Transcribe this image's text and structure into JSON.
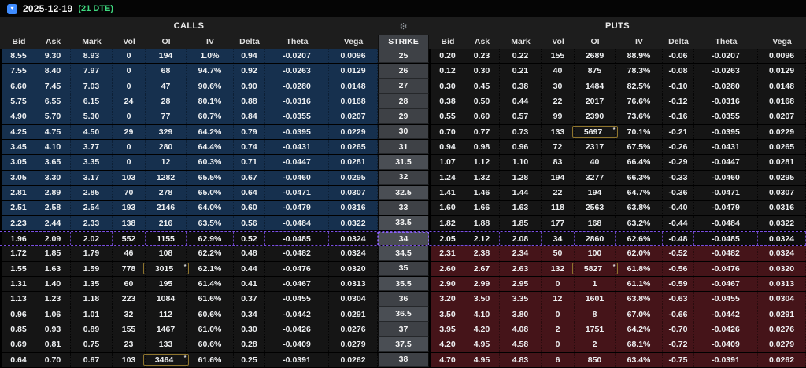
{
  "titlebar": {
    "date": "2025-12-19",
    "dte": "(21 DTE)",
    "expander_icon": "chevron-down",
    "expander_glyph": "▾"
  },
  "header": {
    "calls": "CALLS",
    "puts": "PUTS",
    "strike": "STRIKE",
    "gear_icon": "gear",
    "gear_glyph": "⚙",
    "columns": [
      "Bid",
      "Ask",
      "Mark",
      "Vol",
      "OI",
      "IV",
      "Delta",
      "Theta",
      "Vega"
    ],
    "column_keys": [
      "bid",
      "ask",
      "mark",
      "vol",
      "oi",
      "iv",
      "delta",
      "theta",
      "vega"
    ]
  },
  "colors": {
    "call_itm_bg": "#16304e",
    "put_itm_bg": "#451419",
    "neutral_row_bg": "#151515",
    "strike_bg": "#3e4146",
    "strike_half_bg": "#4a4e54",
    "atm_dash": "#7a4fe0",
    "oi_highlight_border": "#8e742d",
    "dte_green": "#3fd97f",
    "expander_blue": "#3f8cff",
    "header_bg": "#1d1d1d"
  },
  "rows": [
    {
      "strike": "25",
      "half": false,
      "atm": false,
      "call_itm": true,
      "put_itm": false,
      "call_oi_flag": false,
      "put_oi_flag": false,
      "call": [
        "8.55",
        "9.30",
        "8.93",
        "0",
        "194",
        "1.0%",
        "0.94",
        "-0.0207",
        "0.0096"
      ],
      "put": [
        "0.20",
        "0.23",
        "0.22",
        "155",
        "2689",
        "88.9%",
        "-0.06",
        "-0.0207",
        "0.0096"
      ]
    },
    {
      "strike": "26",
      "half": false,
      "atm": false,
      "call_itm": true,
      "put_itm": false,
      "call_oi_flag": false,
      "put_oi_flag": false,
      "call": [
        "7.55",
        "8.40",
        "7.97",
        "0",
        "68",
        "94.7%",
        "0.92",
        "-0.0263",
        "0.0129"
      ],
      "put": [
        "0.12",
        "0.30",
        "0.21",
        "40",
        "875",
        "78.3%",
        "-0.08",
        "-0.0263",
        "0.0129"
      ]
    },
    {
      "strike": "27",
      "half": false,
      "atm": false,
      "call_itm": true,
      "put_itm": false,
      "call_oi_flag": false,
      "put_oi_flag": false,
      "call": [
        "6.60",
        "7.45",
        "7.03",
        "0",
        "47",
        "90.6%",
        "0.90",
        "-0.0280",
        "0.0148"
      ],
      "put": [
        "0.30",
        "0.45",
        "0.38",
        "30",
        "1484",
        "82.5%",
        "-0.10",
        "-0.0280",
        "0.0148"
      ]
    },
    {
      "strike": "28",
      "half": false,
      "atm": false,
      "call_itm": true,
      "put_itm": false,
      "call_oi_flag": false,
      "put_oi_flag": false,
      "call": [
        "5.75",
        "6.55",
        "6.15",
        "24",
        "28",
        "80.1%",
        "0.88",
        "-0.0316",
        "0.0168"
      ],
      "put": [
        "0.38",
        "0.50",
        "0.44",
        "22",
        "2017",
        "76.6%",
        "-0.12",
        "-0.0316",
        "0.0168"
      ]
    },
    {
      "strike": "29",
      "half": false,
      "atm": false,
      "call_itm": true,
      "put_itm": false,
      "call_oi_flag": false,
      "put_oi_flag": false,
      "call": [
        "4.90",
        "5.70",
        "5.30",
        "0",
        "77",
        "60.7%",
        "0.84",
        "-0.0355",
        "0.0207"
      ],
      "put": [
        "0.55",
        "0.60",
        "0.57",
        "99",
        "2390",
        "73.6%",
        "-0.16",
        "-0.0355",
        "0.0207"
      ]
    },
    {
      "strike": "30",
      "half": false,
      "atm": false,
      "call_itm": true,
      "put_itm": false,
      "call_oi_flag": false,
      "put_oi_flag": true,
      "call": [
        "4.25",
        "4.75",
        "4.50",
        "29",
        "329",
        "64.2%",
        "0.79",
        "-0.0395",
        "0.0229"
      ],
      "put": [
        "0.70",
        "0.77",
        "0.73",
        "133",
        "5697",
        "70.1%",
        "-0.21",
        "-0.0395",
        "0.0229"
      ]
    },
    {
      "strike": "31",
      "half": false,
      "atm": false,
      "call_itm": true,
      "put_itm": false,
      "call_oi_flag": false,
      "put_oi_flag": false,
      "call": [
        "3.45",
        "4.10",
        "3.77",
        "0",
        "280",
        "64.4%",
        "0.74",
        "-0.0431",
        "0.0265"
      ],
      "put": [
        "0.94",
        "0.98",
        "0.96",
        "72",
        "2317",
        "67.5%",
        "-0.26",
        "-0.0431",
        "0.0265"
      ]
    },
    {
      "strike": "31.5",
      "half": true,
      "atm": false,
      "call_itm": true,
      "put_itm": false,
      "call_oi_flag": false,
      "put_oi_flag": false,
      "call": [
        "3.05",
        "3.65",
        "3.35",
        "0",
        "12",
        "60.3%",
        "0.71",
        "-0.0447",
        "0.0281"
      ],
      "put": [
        "1.07",
        "1.12",
        "1.10",
        "83",
        "40",
        "66.4%",
        "-0.29",
        "-0.0447",
        "0.0281"
      ]
    },
    {
      "strike": "32",
      "half": false,
      "atm": false,
      "call_itm": true,
      "put_itm": false,
      "call_oi_flag": false,
      "put_oi_flag": false,
      "call": [
        "3.05",
        "3.30",
        "3.17",
        "103",
        "1282",
        "65.5%",
        "0.67",
        "-0.0460",
        "0.0295"
      ],
      "put": [
        "1.24",
        "1.32",
        "1.28",
        "194",
        "3277",
        "66.3%",
        "-0.33",
        "-0.0460",
        "0.0295"
      ]
    },
    {
      "strike": "32.5",
      "half": true,
      "atm": false,
      "call_itm": true,
      "put_itm": false,
      "call_oi_flag": false,
      "put_oi_flag": false,
      "call": [
        "2.81",
        "2.89",
        "2.85",
        "70",
        "278",
        "65.0%",
        "0.64",
        "-0.0471",
        "0.0307"
      ],
      "put": [
        "1.41",
        "1.46",
        "1.44",
        "22",
        "194",
        "64.7%",
        "-0.36",
        "-0.0471",
        "0.0307"
      ]
    },
    {
      "strike": "33",
      "half": false,
      "atm": false,
      "call_itm": true,
      "put_itm": false,
      "call_oi_flag": false,
      "put_oi_flag": false,
      "call": [
        "2.51",
        "2.58",
        "2.54",
        "193",
        "2146",
        "64.0%",
        "0.60",
        "-0.0479",
        "0.0316"
      ],
      "put": [
        "1.60",
        "1.66",
        "1.63",
        "118",
        "2563",
        "63.8%",
        "-0.40",
        "-0.0479",
        "0.0316"
      ]
    },
    {
      "strike": "33.5",
      "half": true,
      "atm": false,
      "call_itm": true,
      "put_itm": false,
      "call_oi_flag": false,
      "put_oi_flag": false,
      "call": [
        "2.23",
        "2.44",
        "2.33",
        "138",
        "216",
        "63.5%",
        "0.56",
        "-0.0484",
        "0.0322"
      ],
      "put": [
        "1.82",
        "1.88",
        "1.85",
        "177",
        "168",
        "63.2%",
        "-0.44",
        "-0.0484",
        "0.0322"
      ]
    },
    {
      "strike": "34",
      "half": false,
      "atm": true,
      "call_itm": false,
      "put_itm": false,
      "call_oi_flag": false,
      "put_oi_flag": false,
      "call": [
        "1.96",
        "2.09",
        "2.02",
        "552",
        "1155",
        "62.9%",
        "0.52",
        "-0.0485",
        "0.0324"
      ],
      "put": [
        "2.05",
        "2.12",
        "2.08",
        "34",
        "2860",
        "62.6%",
        "-0.48",
        "-0.0485",
        "0.0324"
      ]
    },
    {
      "strike": "34.5",
      "half": true,
      "atm": false,
      "call_itm": false,
      "put_itm": true,
      "call_oi_flag": false,
      "put_oi_flag": false,
      "call": [
        "1.72",
        "1.85",
        "1.79",
        "46",
        "108",
        "62.2%",
        "0.48",
        "-0.0482",
        "0.0324"
      ],
      "put": [
        "2.31",
        "2.38",
        "2.34",
        "50",
        "100",
        "62.0%",
        "-0.52",
        "-0.0482",
        "0.0324"
      ]
    },
    {
      "strike": "35",
      "half": false,
      "atm": false,
      "call_itm": false,
      "put_itm": true,
      "call_oi_flag": true,
      "put_oi_flag": true,
      "call": [
        "1.55",
        "1.63",
        "1.59",
        "778",
        "3015",
        "62.1%",
        "0.44",
        "-0.0476",
        "0.0320"
      ],
      "put": [
        "2.60",
        "2.67",
        "2.63",
        "132",
        "5827",
        "61.8%",
        "-0.56",
        "-0.0476",
        "0.0320"
      ]
    },
    {
      "strike": "35.5",
      "half": true,
      "atm": false,
      "call_itm": false,
      "put_itm": true,
      "call_oi_flag": false,
      "put_oi_flag": false,
      "call": [
        "1.31",
        "1.40",
        "1.35",
        "60",
        "195",
        "61.4%",
        "0.41",
        "-0.0467",
        "0.0313"
      ],
      "put": [
        "2.90",
        "2.99",
        "2.95",
        "0",
        "1",
        "61.1%",
        "-0.59",
        "-0.0467",
        "0.0313"
      ]
    },
    {
      "strike": "36",
      "half": false,
      "atm": false,
      "call_itm": false,
      "put_itm": true,
      "call_oi_flag": false,
      "put_oi_flag": false,
      "call": [
        "1.13",
        "1.23",
        "1.18",
        "223",
        "1084",
        "61.6%",
        "0.37",
        "-0.0455",
        "0.0304"
      ],
      "put": [
        "3.20",
        "3.50",
        "3.35",
        "12",
        "1601",
        "63.8%",
        "-0.63",
        "-0.0455",
        "0.0304"
      ]
    },
    {
      "strike": "36.5",
      "half": true,
      "atm": false,
      "call_itm": false,
      "put_itm": true,
      "call_oi_flag": false,
      "put_oi_flag": false,
      "call": [
        "0.96",
        "1.06",
        "1.01",
        "32",
        "112",
        "60.6%",
        "0.34",
        "-0.0442",
        "0.0291"
      ],
      "put": [
        "3.50",
        "4.10",
        "3.80",
        "0",
        "8",
        "67.0%",
        "-0.66",
        "-0.0442",
        "0.0291"
      ]
    },
    {
      "strike": "37",
      "half": false,
      "atm": false,
      "call_itm": false,
      "put_itm": true,
      "call_oi_flag": false,
      "put_oi_flag": false,
      "call": [
        "0.85",
        "0.93",
        "0.89",
        "155",
        "1467",
        "61.0%",
        "0.30",
        "-0.0426",
        "0.0276"
      ],
      "put": [
        "3.95",
        "4.20",
        "4.08",
        "2",
        "1751",
        "64.2%",
        "-0.70",
        "-0.0426",
        "0.0276"
      ]
    },
    {
      "strike": "37.5",
      "half": true,
      "atm": false,
      "call_itm": false,
      "put_itm": true,
      "call_oi_flag": false,
      "put_oi_flag": false,
      "call": [
        "0.69",
        "0.81",
        "0.75",
        "23",
        "133",
        "60.6%",
        "0.28",
        "-0.0409",
        "0.0279"
      ],
      "put": [
        "4.20",
        "4.95",
        "4.58",
        "0",
        "2",
        "68.1%",
        "-0.72",
        "-0.0409",
        "0.0279"
      ]
    },
    {
      "strike": "38",
      "half": false,
      "atm": false,
      "call_itm": false,
      "put_itm": true,
      "call_oi_flag": true,
      "put_oi_flag": false,
      "call": [
        "0.64",
        "0.70",
        "0.67",
        "103",
        "3464",
        "61.6%",
        "0.25",
        "-0.0391",
        "0.0262"
      ],
      "put": [
        "4.70",
        "4.95",
        "4.83",
        "6",
        "850",
        "63.4%",
        "-0.75",
        "-0.0391",
        "0.0262"
      ]
    }
  ]
}
